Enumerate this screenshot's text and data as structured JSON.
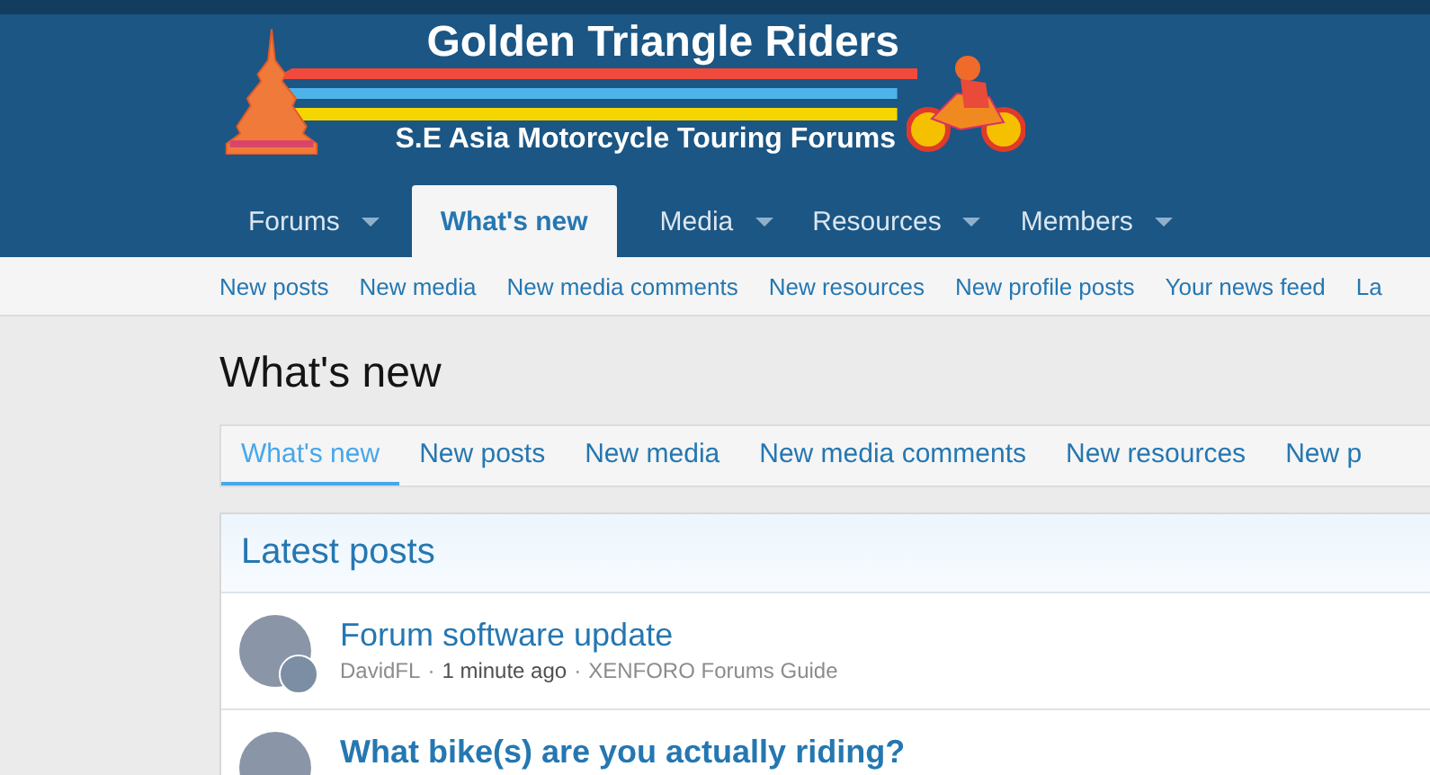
{
  "logo": {
    "title": "Golden Triangle Riders",
    "subtitle": "S.E Asia Motorcycle Touring Forums"
  },
  "nav": [
    {
      "label": "Forums",
      "selected": false,
      "menu": true
    },
    {
      "label": "What's new",
      "selected": true,
      "menu": false
    },
    {
      "label": "Media",
      "selected": false,
      "menu": true
    },
    {
      "label": "Resources",
      "selected": false,
      "menu": true
    },
    {
      "label": "Members",
      "selected": false,
      "menu": true
    }
  ],
  "subnav": [
    "New posts",
    "New media",
    "New media comments",
    "New resources",
    "New profile posts",
    "Your news feed",
    "La"
  ],
  "page_title": "What's new",
  "tabs": [
    {
      "label": "What's new",
      "selected": true
    },
    {
      "label": "New posts",
      "selected": false
    },
    {
      "label": "New media",
      "selected": false
    },
    {
      "label": "New media comments",
      "selected": false
    },
    {
      "label": "New resources",
      "selected": false
    },
    {
      "label": "New p",
      "selected": false
    }
  ],
  "block": {
    "title": "Latest posts",
    "items": [
      {
        "title": "Forum software update",
        "unread": false,
        "author": "DavidFL",
        "separator": "·",
        "time": "1 minute ago",
        "forum": "XENFORO Forums Guide",
        "small_avatar": true
      },
      {
        "title": "What bike(s) are you actually riding?",
        "unread": true,
        "small_avatar": false
      }
    ]
  }
}
